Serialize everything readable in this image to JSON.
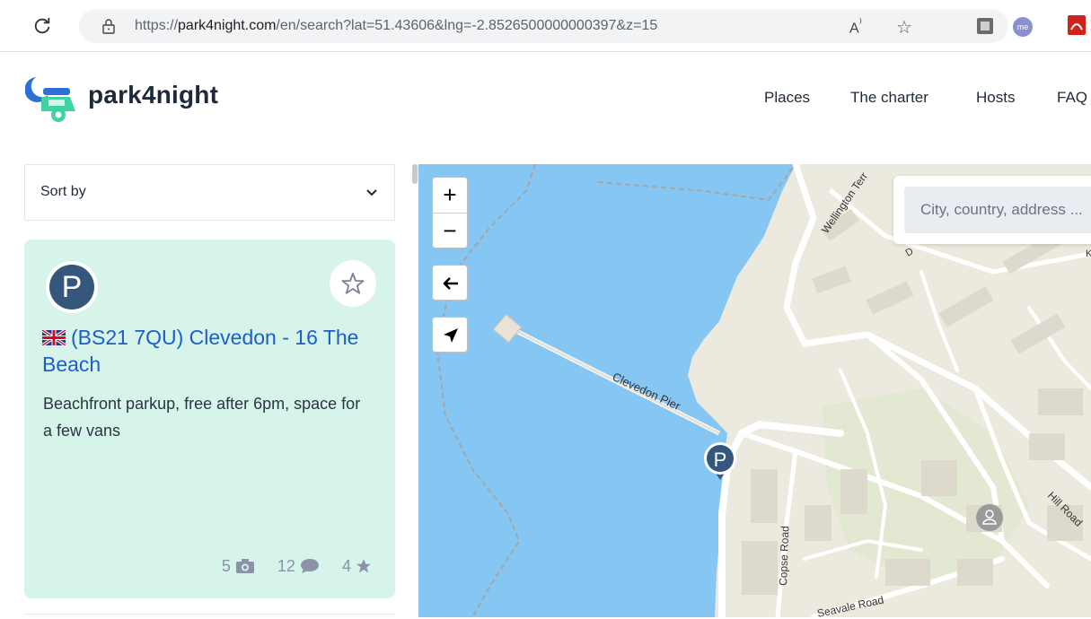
{
  "browser": {
    "url_prefix": "https://",
    "url_domain": "park4night.com",
    "url_path": "/en/search?lat=51.43606&lng=-2.8526500000000397&z=15",
    "read_aloud_label": "A",
    "profile_initials": "me"
  },
  "header": {
    "brand": "park4night",
    "nav": [
      "Places",
      "The charter",
      "Hosts",
      "FAQ"
    ]
  },
  "sort": {
    "label": "Sort by"
  },
  "place_card": {
    "marker_letter": "P",
    "title": "(BS21 7QU) Clevedon - 16 The Beach",
    "description": "Beachfront parkup, free after 6pm, space for a few vans",
    "photos": "5",
    "comments": "12",
    "rating": "4"
  },
  "map": {
    "zoom_in": "+",
    "zoom_out": "−",
    "search_placeholder": "City, country, address ...",
    "labels": {
      "pier": "Clevedon Pier",
      "wellington": "Wellington Terr",
      "hill": "Hill Road",
      "copse": "Copse Road",
      "seavale": "Seavale Road",
      "d_label": "D",
      "k_label": "K"
    },
    "marker_letter": "P",
    "colors": {
      "water": "#86c6f3",
      "land": "#ece9de",
      "accent": "#36577d",
      "card": "#d6f4ea",
      "title": "#1d5fc7"
    }
  }
}
